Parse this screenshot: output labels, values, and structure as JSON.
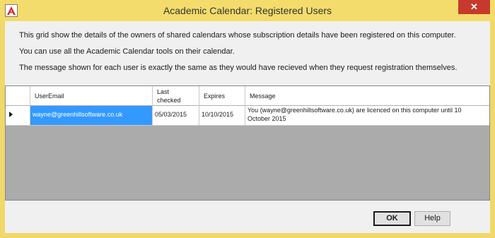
{
  "window": {
    "title": "Academic Calendar: Registered Users",
    "close_glyph": "✕",
    "icon": "academic-calendar-app-icon"
  },
  "info": {
    "line1": "This grid show the details of the owners of shared calendars whose subscription details have been registered on this computer.",
    "line2": "You can use all the Academic Calendar tools on their calendar.",
    "line3": "The message shown for each user is exactly the same as they would have recieved when they request registration themselves."
  },
  "grid": {
    "columns": {
      "user_email": "UserEmail",
      "last_checked_1": "Last",
      "last_checked_2": "checked",
      "expires": "Expires",
      "message": "Message"
    },
    "rows": [
      {
        "user_email": "wayne@greenhillsoftware.co.uk",
        "last_checked": "05/03/2015",
        "expires": "10/10/2015",
        "message_1": "You (wayne@greenhillsoftware.co.uk) are licenced on this computer until 10",
        "message_2": "October 2015"
      }
    ]
  },
  "buttons": {
    "ok": "OK",
    "help": "Help"
  },
  "colors": {
    "title_bar": "#f3dc6b",
    "selection": "#3399ff",
    "close_button": "#c7392c"
  }
}
